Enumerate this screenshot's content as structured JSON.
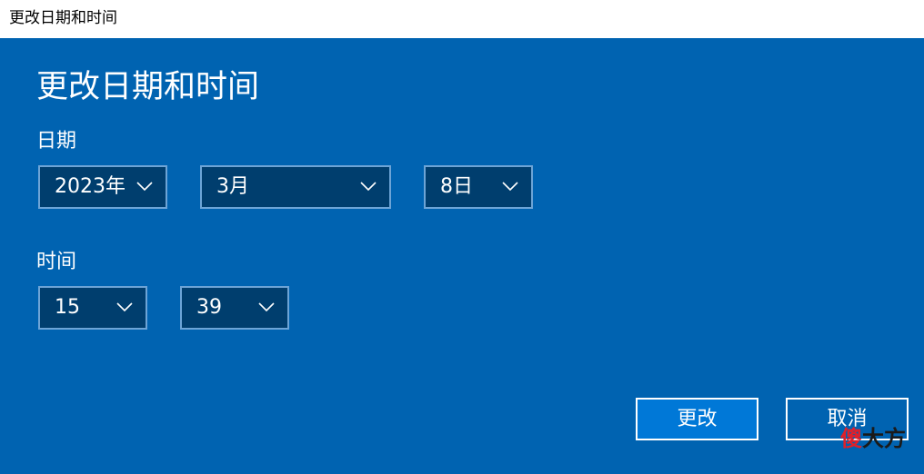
{
  "window": {
    "title": "更改日期和时间"
  },
  "dialog": {
    "heading": "更改日期和时间",
    "date_label": "日期",
    "time_label": "时间",
    "year": "2023年",
    "month": "3月",
    "day": "8日",
    "hour": "15",
    "minute": "39"
  },
  "buttons": {
    "change": "更改",
    "cancel": "取消"
  },
  "watermark": {
    "part1": "傻",
    "part2": "大方"
  },
  "colors": {
    "background": "#0063b1",
    "dropdown_bg": "#003e6e",
    "dropdown_border": "#6da4d6",
    "primary_button": "#0078d7"
  },
  "icons": {
    "dropdown": "chevron-down-icon"
  }
}
